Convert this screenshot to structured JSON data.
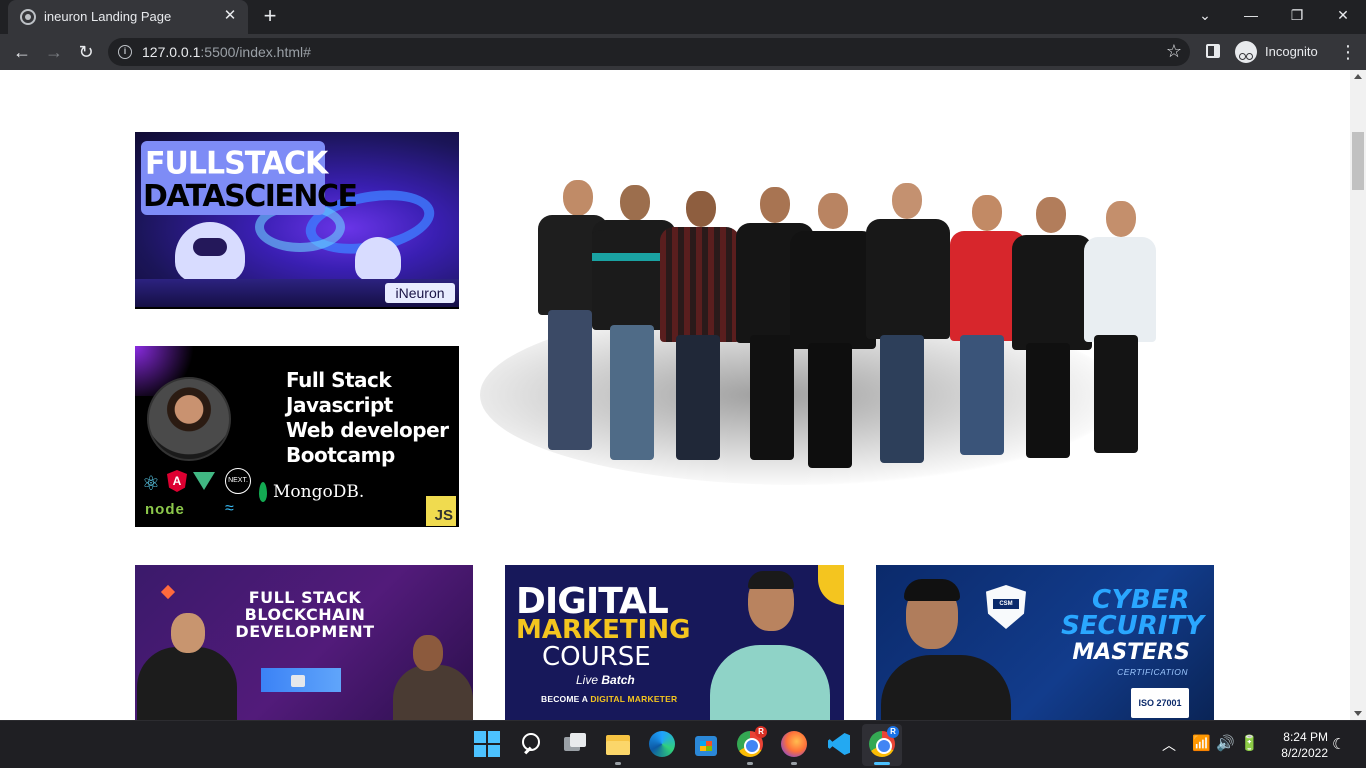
{
  "browser": {
    "tab_title": "ineuron Landing Page",
    "tab_close": "✕",
    "new_tab": "+",
    "url_host": "127.0.0.1",
    "url_rest": ":5500/index.html#",
    "profile_label": "Incognito",
    "window_controls": {
      "minimize": "—",
      "restore": "❐",
      "close": "✕",
      "tab_search": "⌄"
    }
  },
  "cards": {
    "datascience": {
      "line1": "FULLSTACK",
      "line2": "DATASCIENCE",
      "logo": "iNeuron"
    },
    "javascript": {
      "lines": [
        "Full Stack",
        "Javascript",
        "Web developer",
        "Bootcamp"
      ],
      "tech": {
        "react": "⚛",
        "angular": "A",
        "next": "NEXT.",
        "mongodb": "MongoDB.",
        "node": "node",
        "tailwind": "≈",
        "js": "JS"
      }
    },
    "blockchain": {
      "lines": [
        "FULL STACK",
        "BLOCKCHAIN",
        "DEVELOPMENT"
      ]
    },
    "digital_marketing": {
      "line1": "DIGITAL",
      "line2": "MARKETING",
      "line3": "COURSE",
      "live_1": "Live",
      "live_2": "Batch",
      "cta_1": "BECOME A",
      "cta_2": "DIGITAL MARKETER"
    },
    "cyber_security": {
      "line1": "CYBER",
      "line2": "SECURITY",
      "line3": "MASTERS",
      "sub": "CERTIFICATION",
      "badge": "CSM",
      "iso": "ISO 27001"
    }
  },
  "taskbar": {
    "clock_time": "8:24 PM",
    "clock_date": "8/2/2022",
    "chrome_badge_1": "R",
    "chrome_badge_2": "R"
  }
}
